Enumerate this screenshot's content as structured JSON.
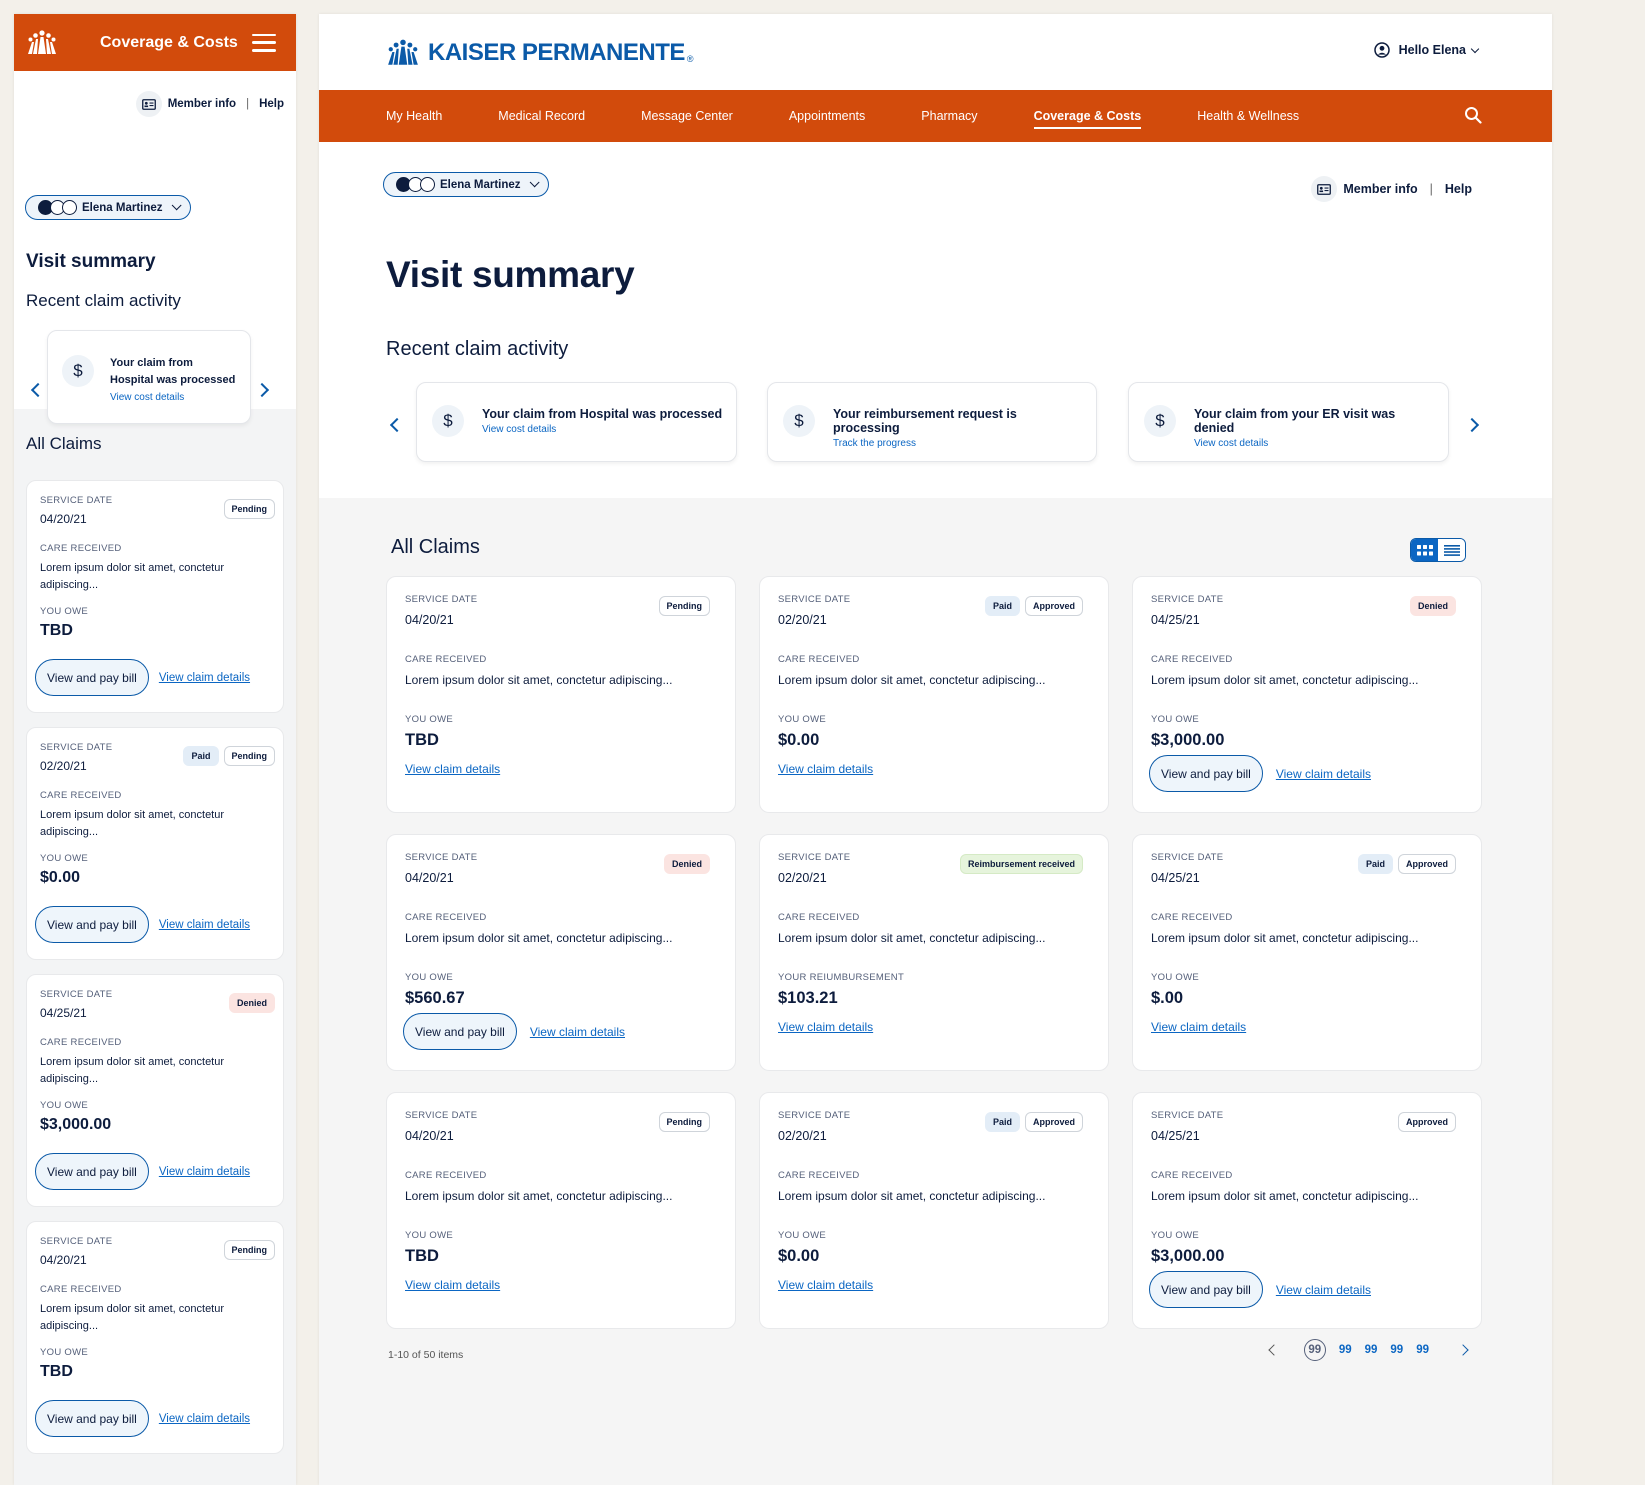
{
  "colors": {
    "brand_orange": "#d24b0c",
    "brand_blue": "#0b5aa8",
    "link": "#0b66c3",
    "navy": "#0d1c3d"
  },
  "mobile": {
    "header_title": "Coverage & Costs",
    "member_info": "Member info",
    "help": "Help",
    "member_name": "Elena Martinez",
    "title": "Visit summary",
    "recent_title": "Recent claim activity",
    "activity": {
      "text": "Your claim from Hospital was processed",
      "link": "View cost details"
    },
    "all_claims_title": "All Claims",
    "claims": [
      {
        "service_label": "SERVICE DATE",
        "date": "04/20/21",
        "badges": [
          {
            "text": "Pending",
            "kind": "default"
          }
        ],
        "care_label": "CARE RECEIVED",
        "care": "Lorem ipsum dolor sit amet, conctetur adipiscing...",
        "owe_label": "YOU OWE",
        "amount": "TBD",
        "pay": "View and pay bill",
        "details": "View claim details"
      },
      {
        "service_label": "SERVICE DATE",
        "date": "02/20/21",
        "badges": [
          {
            "text": "Paid",
            "kind": "paid"
          },
          {
            "text": "Pending",
            "kind": "default"
          }
        ],
        "care_label": "CARE RECEIVED",
        "care": "Lorem ipsum dolor sit amet, conctetur adipiscing...",
        "owe_label": "YOU OWE",
        "amount": "$0.00",
        "pay": "View and pay bill",
        "details": "View claim details"
      },
      {
        "service_label": "SERVICE DATE",
        "date": "04/25/21",
        "badges": [
          {
            "text": "Denied",
            "kind": "denied"
          }
        ],
        "care_label": "CARE RECEIVED",
        "care": "Lorem ipsum dolor sit amet, conctetur adipiscing...",
        "owe_label": "YOU OWE",
        "amount": "$3,000.00",
        "pay": "View and pay bill",
        "details": "View claim details"
      },
      {
        "service_label": "SERVICE DATE",
        "date": "04/20/21",
        "badges": [
          {
            "text": "Pending",
            "kind": "default"
          }
        ],
        "care_label": "CARE RECEIVED",
        "care": "Lorem ipsum dolor sit amet, conctetur adipiscing...",
        "owe_label": "YOU OWE",
        "amount": "TBD",
        "pay": "View and pay bill",
        "details": "View claim details"
      }
    ]
  },
  "desktop": {
    "brand": "KAISER PERMANENTE",
    "brand_reg": "®",
    "greeting": "Hello Elena",
    "nav": [
      "My Health",
      "Medical Record",
      "Message Center",
      "Appointments",
      "Pharmacy",
      "Coverage & Costs",
      "Health & Wellness"
    ],
    "nav_active": "Coverage & Costs",
    "member_name": "Elena Martinez",
    "member_info": "Member info",
    "help": "Help",
    "title": "Visit summary",
    "recent_title": "Recent claim activity",
    "activities": [
      {
        "text": "Your claim from Hospital was processed",
        "link": "View cost details"
      },
      {
        "text": "Your reimbursement request is processing",
        "link": "Track the progress"
      },
      {
        "text": "Your claim from your ER visit was denied",
        "link": "View cost details"
      }
    ],
    "all_claims_title": "All Claims",
    "claims": [
      {
        "service_label": "SERVICE DATE",
        "date": "04/20/21",
        "badges": [
          {
            "text": "Pending",
            "kind": "default"
          }
        ],
        "care_label": "CARE RECEIVED",
        "care": "Lorem ipsum dolor sit amet, conctetur adipiscing...",
        "owe_label": "YOU OWE",
        "amount": "TBD",
        "pay": "",
        "details": "View claim details"
      },
      {
        "service_label": "SERVICE DATE",
        "date": "02/20/21",
        "badges": [
          {
            "text": "Paid",
            "kind": "paid"
          },
          {
            "text": "Approved",
            "kind": "default"
          }
        ],
        "care_label": "CARE RECEIVED",
        "care": "Lorem ipsum dolor sit amet, conctetur adipiscing...",
        "owe_label": "YOU OWE",
        "amount": "$0.00",
        "pay": "",
        "details": "View claim details"
      },
      {
        "service_label": "SERVICE DATE",
        "date": "04/25/21",
        "badges": [
          {
            "text": "Denied",
            "kind": "denied"
          }
        ],
        "care_label": "CARE RECEIVED",
        "care": "Lorem ipsum dolor sit amet, conctetur adipiscing...",
        "owe_label": "YOU OWE",
        "amount": "$3,000.00",
        "pay": "View and pay bill",
        "details": "View claim details"
      },
      {
        "service_label": "SERVICE DATE",
        "date": "04/20/21",
        "badges": [
          {
            "text": "Denied",
            "kind": "denied"
          }
        ],
        "care_label": "CARE RECEIVED",
        "care": "Lorem ipsum dolor sit amet, conctetur adipiscing...",
        "owe_label": "YOU OWE",
        "amount": "$560.67",
        "pay": "View and pay bill",
        "details": "View claim details"
      },
      {
        "service_label": "SERVICE DATE",
        "date": "02/20/21",
        "badges": [
          {
            "text": "Reimbursement received",
            "kind": "reimb"
          }
        ],
        "care_label": "CARE RECEIVED",
        "care": "Lorem ipsum dolor sit amet, conctetur adipiscing...",
        "owe_label": "YOUR REIUMBURSEMENT",
        "amount": "$103.21",
        "pay": "",
        "details": "View claim details"
      },
      {
        "service_label": "SERVICE DATE",
        "date": "04/25/21",
        "badges": [
          {
            "text": "Paid",
            "kind": "paid"
          },
          {
            "text": "Approved",
            "kind": "default"
          }
        ],
        "care_label": "CARE RECEIVED",
        "care": "Lorem ipsum dolor sit amet, conctetur adipiscing...",
        "owe_label": "YOU OWE",
        "amount": "$.00",
        "pay": "",
        "details": "View claim details"
      },
      {
        "service_label": "SERVICE DATE",
        "date": "04/20/21",
        "badges": [
          {
            "text": "Pending",
            "kind": "default"
          }
        ],
        "care_label": "CARE RECEIVED",
        "care": "Lorem ipsum dolor sit amet, conctetur adipiscing...",
        "owe_label": "YOU OWE",
        "amount": "TBD",
        "pay": "",
        "details": "View claim details"
      },
      {
        "service_label": "SERVICE DATE",
        "date": "02/20/21",
        "badges": [
          {
            "text": "Paid",
            "kind": "paid"
          },
          {
            "text": "Approved",
            "kind": "default"
          }
        ],
        "care_label": "CARE RECEIVED",
        "care": "Lorem ipsum dolor sit amet, conctetur adipiscing...",
        "owe_label": "YOU OWE",
        "amount": "$0.00",
        "pay": "",
        "details": "View claim details"
      },
      {
        "service_label": "SERVICE DATE",
        "date": "04/25/21",
        "badges": [
          {
            "text": "Approved",
            "kind": "default"
          }
        ],
        "care_label": "CARE RECEIVED",
        "care": "Lorem ipsum dolor sit amet, conctetur adipiscing...",
        "owe_label": "YOU OWE",
        "amount": "$3,000.00",
        "pay": "View and pay bill",
        "details": "View claim details"
      }
    ],
    "pager_info": "1-10 of 50 items",
    "pages": [
      "99",
      "99",
      "99",
      "99",
      "99"
    ],
    "current_page": "99"
  }
}
